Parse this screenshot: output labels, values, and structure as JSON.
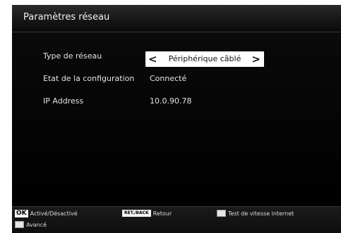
{
  "header": {
    "title": "Paramètres réseau"
  },
  "settings": {
    "network_type": {
      "label": "Type de réseau",
      "value": "Périphérique câblé",
      "left_icon": "chevron-left-icon",
      "right_icon": "chevron-right-icon"
    },
    "config_state": {
      "label": "Etat de la configuration",
      "value": "Connecté"
    },
    "ip_address": {
      "label": "IP Address",
      "value": "10.0.90.78"
    }
  },
  "footer": {
    "ok": {
      "key": "OK",
      "label": "Activé/Désactivé"
    },
    "back": {
      "key": "RET./BACK",
      "label": "Retour"
    },
    "speed_test": {
      "label": "Test de vitesse internet"
    },
    "advanced": {
      "label": "Avancé"
    }
  },
  "colors": {
    "background": "#000000",
    "text": "#e4e4e4",
    "selector_bg": "#ffffff"
  }
}
